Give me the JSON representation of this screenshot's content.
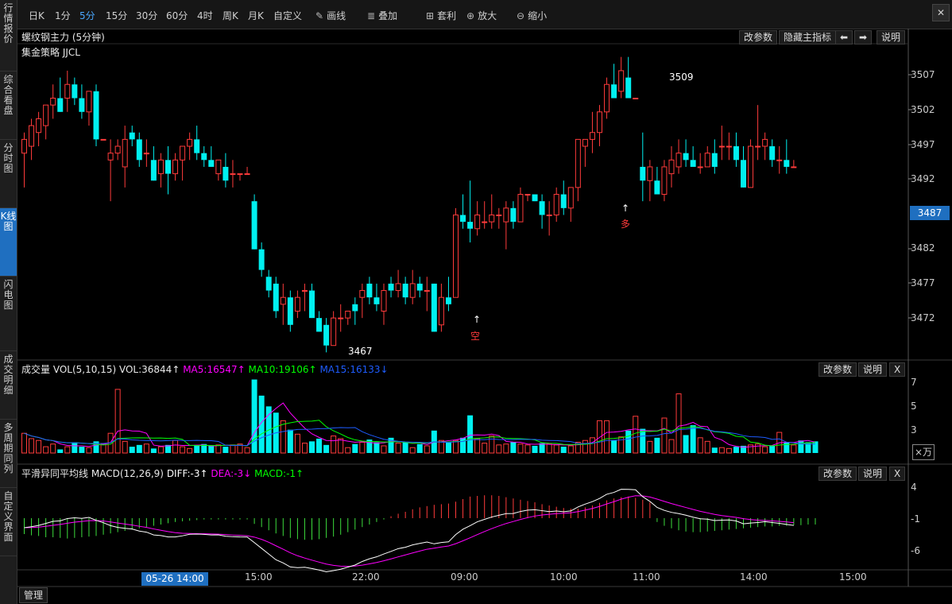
{
  "sidebar": {
    "items": [
      {
        "label": "行情报价"
      },
      {
        "label": "综合看盘"
      },
      {
        "label": "分时图"
      },
      {
        "label": "K线图"
      },
      {
        "label": "闪电图"
      },
      {
        "label": "成交明细"
      },
      {
        "label": "多周期同列"
      },
      {
        "label": "自定义界面"
      }
    ]
  },
  "toolbar": {
    "periods": [
      "日K",
      "1分",
      "5分",
      "15分",
      "30分",
      "60分",
      "4时",
      "周K",
      "月K",
      "自定义"
    ],
    "active_period": "5分",
    "tools": [
      {
        "label": "画线",
        "icon": "pencil-icon"
      },
      {
        "label": "叠加",
        "icon": "stack-icon"
      },
      {
        "label": "套利",
        "icon": "arbitrage-icon"
      },
      {
        "label": "放大",
        "icon": "zoom-in-icon"
      },
      {
        "label": "缩小",
        "icon": "zoom-out-icon"
      }
    ]
  },
  "main_panel": {
    "title": "螺纹钢主力 (5分钟)",
    "strategy": "集金策略 JJCL",
    "buttons": {
      "params": "改参数",
      "hide": "隐藏主指标",
      "help": "说明"
    },
    "price_ticks": [
      "3507",
      "3502",
      "3497",
      "3492",
      "3482",
      "3477",
      "3472"
    ],
    "current_price": "3487",
    "labels": {
      "high": "3509",
      "low": "3467",
      "signal_short": "空",
      "signal_long": "多"
    }
  },
  "vol_panel": {
    "name": "成交量",
    "params": "VOL(5,10,15)",
    "vol": "VOL:36844↑",
    "ma5": "MA5:16547↑",
    "ma10": "MA10:19106↑",
    "ma15": "MA15:16133↓",
    "ticks": [
      "7",
      "5",
      "3"
    ],
    "unit": "×万",
    "buttons": {
      "params": "改参数",
      "help": "说明",
      "close": "X"
    }
  },
  "macd_panel": {
    "name": "平滑异同平均线",
    "params": "MACD(12,26,9)",
    "diff": "DIFF:-3↑",
    "dea": "DEA:-3↓",
    "macd": "MACD:-1↑",
    "ticks": [
      "4",
      "-1",
      "-6"
    ],
    "buttons": {
      "params": "改参数",
      "help": "说明",
      "close": "X"
    }
  },
  "time_axis": {
    "highlight": "05-26 14:00",
    "labels": [
      "15:00",
      "22:00",
      "09:00",
      "10:00",
      "11:00",
      "14:00",
      "15:00"
    ]
  },
  "bottom_tab": "管理",
  "colors": {
    "up": "#ff3b3b",
    "down": "#00f0f0",
    "accent": "#1f6fc0",
    "ma5": "#ff00ff",
    "ma10": "#00ff00",
    "ma15": "#1e5cff",
    "diff": "#ffffff",
    "dea": "#ff00ff"
  },
  "chart_data": {
    "type": "candlestick",
    "ylim": [
      3465,
      3510
    ],
    "candles": [
      [
        3495,
        3498,
        3490,
        3497
      ],
      [
        3496,
        3500,
        3494,
        3499
      ],
      [
        3498,
        3501,
        3496,
        3500
      ],
      [
        3499,
        3502,
        3497,
        3502
      ],
      [
        3502,
        3505,
        3500,
        3503
      ],
      [
        3503,
        3506,
        3501,
        3501
      ],
      [
        3503,
        3507,
        3501,
        3505
      ],
      [
        3505,
        3506,
        3502,
        3503
      ],
      [
        3503,
        3505,
        3500,
        3501
      ],
      [
        3501,
        3504,
        3499,
        3504
      ],
      [
        3504,
        3505,
        3496,
        3497
      ],
      [
        3497,
        3497,
        3497,
        3497
      ],
      [
        3494,
        3497,
        3488,
        3495
      ],
      [
        3495,
        3497,
        3494,
        3496
      ],
      [
        3493,
        3499,
        3490,
        3497
      ],
      [
        3498,
        3499,
        3496,
        3497
      ],
      [
        3497,
        3498,
        3493,
        3494
      ],
      [
        3495,
        3497,
        3493,
        3495
      ],
      [
        3494,
        3496,
        3491,
        3491
      ],
      [
        3492,
        3495,
        3490,
        3494
      ],
      [
        3494,
        3496,
        3489,
        3492
      ],
      [
        3492,
        3495,
        3491,
        3494
      ],
      [
        3494,
        3496,
        3491,
        3496
      ],
      [
        3496,
        3498,
        3494,
        3497
      ],
      [
        3497,
        3499,
        3494,
        3495
      ],
      [
        3495,
        3496,
        3493,
        3494
      ],
      [
        3494,
        3496,
        3493,
        3493
      ],
      [
        3492,
        3494,
        3491,
        3494
      ],
      [
        3493,
        3495,
        3490,
        3491
      ],
      [
        3492,
        3494,
        3490,
        3492
      ],
      [
        3492,
        3492,
        3491,
        3492
      ],
      [
        3492,
        3493,
        3492,
        3492
      ],
      [
        3488,
        3489,
        3481,
        3481
      ],
      [
        3481,
        3482,
        3477,
        3478
      ],
      [
        3477,
        3478,
        3474,
        3475
      ],
      [
        3476,
        3477,
        3471,
        3472
      ],
      [
        3473,
        3476,
        3470,
        3474
      ],
      [
        3474,
        3475,
        3469,
        3470
      ],
      [
        3472,
        3475,
        3471,
        3474
      ],
      [
        3475,
        3476,
        3472,
        3475
      ],
      [
        3475,
        3476,
        3471,
        3471
      ],
      [
        3471,
        3472,
        3469,
        3469
      ],
      [
        3470,
        3471,
        3466,
        3467
      ],
      [
        3467,
        3472,
        3467,
        3471
      ],
      [
        3471,
        3473,
        3469,
        3471
      ],
      [
        3471,
        3472,
        3470,
        3472
      ],
      [
        3473,
        3474,
        3470,
        3472
      ],
      [
        3474,
        3476,
        3471,
        3475
      ],
      [
        3476,
        3477,
        3473,
        3474
      ],
      [
        3474,
        3476,
        3472,
        3473
      ],
      [
        3472,
        3476,
        3470,
        3475
      ],
      [
        3476,
        3477,
        3474,
        3475
      ],
      [
        3475,
        3478,
        3474,
        3476
      ],
      [
        3476,
        3477,
        3473,
        3474
      ],
      [
        3474,
        3478,
        3473,
        3476
      ],
      [
        3476,
        3477,
        3474,
        3475
      ],
      [
        3475,
        3477,
        3472,
        3475
      ],
      [
        3476,
        3476,
        3469,
        3469
      ],
      [
        3470,
        3476,
        3469,
        3474
      ],
      [
        3474,
        3477,
        3472,
        3473
      ],
      [
        3474,
        3487,
        3474,
        3486
      ],
      [
        3486,
        3489,
        3484,
        3485
      ],
      [
        3485,
        3491,
        3482,
        3484
      ],
      [
        3484,
        3488,
        3483,
        3486
      ],
      [
        3485,
        3488,
        3484,
        3485
      ],
      [
        3485,
        3489,
        3484,
        3486
      ],
      [
        3486,
        3487,
        3484,
        3486
      ],
      [
        3485,
        3488,
        3481,
        3487
      ],
      [
        3487,
        3488,
        3484,
        3485
      ],
      [
        3485,
        3490,
        3485,
        3489
      ],
      [
        3489,
        3489,
        3488,
        3489
      ],
      [
        3489,
        3489,
        3488,
        3488
      ],
      [
        3488,
        3489,
        3484,
        3486
      ],
      [
        3486,
        3488,
        3483,
        3486
      ],
      [
        3486,
        3490,
        3485,
        3489
      ],
      [
        3489,
        3491,
        3486,
        3487
      ],
      [
        3487,
        3490,
        3485,
        3490
      ],
      [
        3490,
        3494,
        3488,
        3497
      ],
      [
        3496,
        3497,
        3493,
        3497
      ],
      [
        3497,
        3501,
        3495,
        3498
      ],
      [
        3498,
        3502,
        3496,
        3501
      ],
      [
        3501,
        3506,
        3500,
        3505
      ],
      [
        3505,
        3508,
        3503,
        3503
      ],
      [
        3504,
        3509,
        3503,
        3507
      ],
      [
        3506,
        3509,
        3503,
        3503
      ],
      [
        3503,
        3503,
        3503,
        3503
      ],
      [
        3493,
        3498,
        3488,
        3491
      ],
      [
        3491,
        3494,
        3488,
        3493
      ],
      [
        3491,
        3493,
        3489,
        3489
      ],
      [
        3489,
        3494,
        3488,
        3493
      ],
      [
        3492,
        3496,
        3490,
        3494
      ],
      [
        3493,
        3497,
        3492,
        3495
      ],
      [
        3495,
        3497,
        3493,
        3494
      ],
      [
        3494,
        3496,
        3493,
        3493
      ],
      [
        3493,
        3495,
        3492,
        3493
      ],
      [
        3493,
        3496,
        3493,
        3495
      ],
      [
        3495,
        3497,
        3492,
        3493
      ],
      [
        3496,
        3499,
        3494,
        3496
      ],
      [
        3496,
        3498,
        3494,
        3496
      ],
      [
        3496,
        3498,
        3493,
        3494
      ],
      [
        3494,
        3496,
        3490,
        3490
      ],
      [
        3490,
        3497,
        3490,
        3496
      ],
      [
        3496,
        3502,
        3494,
        3496
      ],
      [
        3496,
        3498,
        3494,
        3497
      ],
      [
        3496,
        3497,
        3493,
        3494
      ],
      [
        3494,
        3496,
        3492,
        3494
      ],
      [
        3494,
        3497,
        3492,
        3493
      ],
      [
        3493,
        3494,
        3493,
        3493
      ]
    ],
    "volume_wan": [
      2.2,
      1.6,
      1.4,
      0.7,
      1.0,
      0.4,
      0.7,
      1.2,
      0.7,
      0.6,
      1.3,
      1.0,
      2.2,
      7.1,
      1.3,
      0.7,
      0.9,
      1.0,
      0.5,
      0.7,
      0.9,
      1.4,
      0.7,
      0.5,
      0.9,
      1.0,
      0.8,
      0.9,
      0.7,
      0.9,
      1.0,
      0.6,
      8.2,
      6.4,
      5.2,
      4.5,
      3.6,
      2.6,
      2.1,
      1.1,
      1.3,
      1.6,
      0.9,
      1.9,
      1.6,
      0.6,
      1.0,
      1.2,
      1.5,
      1.2,
      0.8,
      1.7,
      1.1,
      1.2,
      0.6,
      1.0,
      0.8,
      2.5,
      1.4,
      1.2,
      1.4,
      1.7,
      4.2,
      1.6,
      1.1,
      1.9,
      0.9,
      1.0,
      1.2,
      1.0,
      0.9,
      0.8,
      1.1,
      1.0,
      0.9,
      0.7,
      0.8,
      1.2,
      1.4,
      1.7,
      3.6,
      3.6,
      1.4,
      1.8,
      2.5,
      4.1,
      2.7,
      1.3,
      1.7,
      3.9,
      1.5,
      6.6,
      2.0,
      3.1,
      1.7,
      1.3,
      0.6,
      0.6,
      0.5,
      0.7,
      0.8,
      0.9,
      1.0,
      0.7,
      0.8,
      2.3,
      1.2,
      0.9,
      1.4,
      1.2,
      1.3
    ],
    "macd_bar": [
      -2.5,
      -2.7,
      -2.8,
      -3.0,
      -3.0,
      -3.1,
      -3.2,
      -3.1,
      -3.0,
      -2.9,
      -2.8,
      -2.6,
      -2.4,
      -2.2,
      -2.0,
      -1.8,
      -1.6,
      -1.4,
      -1.2,
      -1.0,
      -0.8,
      -0.6,
      -0.5,
      -0.4,
      -0.3,
      -0.2,
      -0.2,
      -0.2,
      -0.2,
      -0.2,
      -0.2,
      -0.2,
      -0.9,
      -1.4,
      -1.9,
      -2.4,
      -2.8,
      -3.1,
      -3.3,
      -3.4,
      -3.4,
      -3.3,
      -3.1,
      -2.9,
      -2.6,
      -2.2,
      -1.8,
      -1.4,
      -1.0,
      -0.6,
      -0.2,
      0.3,
      0.7,
      1.0,
      1.4,
      1.7,
      1.9,
      2.1,
      2.2,
      2.3,
      2.6,
      3.0,
      3.4,
      3.5,
      3.6,
      3.6,
      3.5,
      3.3,
      3.1,
      2.9,
      2.7,
      2.5,
      2.2,
      2.0,
      1.8,
      1.6,
      1.5,
      1.5,
      1.7,
      2.0,
      2.4,
      2.8,
      3.1,
      3.3,
      3.4,
      3.2,
      2.9,
      2.5,
      -0.6,
      -1.2,
      -1.6,
      -1.9,
      -2.1,
      -2.2,
      -2.2,
      -2.1,
      -2.0,
      -1.9,
      -1.8,
      -1.7,
      -1.6,
      -1.5,
      -1.4,
      -1.3,
      -1.3,
      -1.2,
      -1.2,
      -1.1,
      -1.1,
      -1.0,
      -1.0
    ]
  }
}
